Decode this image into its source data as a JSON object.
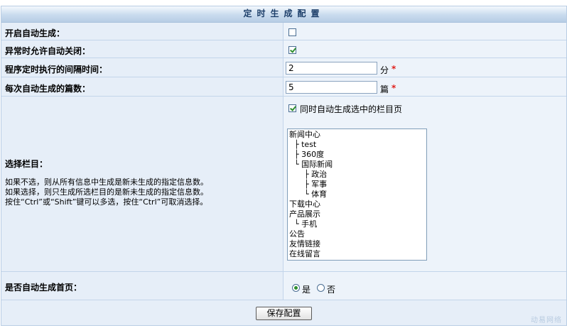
{
  "title": "定时生成配置",
  "settings": {
    "enable_auto": {
      "label": "开启自动生成：",
      "checked": false
    },
    "allow_close_on_error": {
      "label": "异常时允许自动关闭：",
      "checked": true
    },
    "interval": {
      "label": "程序定时执行的间隔时间：",
      "value": "2",
      "unit": "分",
      "required_mark": "*"
    },
    "per_batch": {
      "label": "每次自动生成的篇数：",
      "value": "5",
      "unit": "篇",
      "required_mark": "*"
    }
  },
  "columns": {
    "label": "选择栏目：",
    "also_generate_label": "同时自动生成选中的栏目页",
    "also_generate_checked": true,
    "help": [
      "如果不选，则从所有信息中生成是新未生成的指定信息数。",
      "如果选择，则只生成所选栏目的是新未生成的指定信息数。",
      "按住“Ctrl”或“Shift”键可以多选，按住“Ctrl”可取消选择。"
    ],
    "options": [
      "新闻中心",
      "  ├ test",
      "  ├ 360度",
      "  └ 国际新闻",
      "      ├ 政治",
      "      ├ 军事",
      "      └ 体育",
      "下载中心",
      "产品展示",
      "  └ 手机",
      "公告",
      "友情链接",
      "在线留言"
    ]
  },
  "homepage": {
    "label": "是否自动生成首页：",
    "yes_label": "是",
    "no_label": "否",
    "selected": "yes"
  },
  "save_button": "保存配置",
  "watermark": "动易网络"
}
